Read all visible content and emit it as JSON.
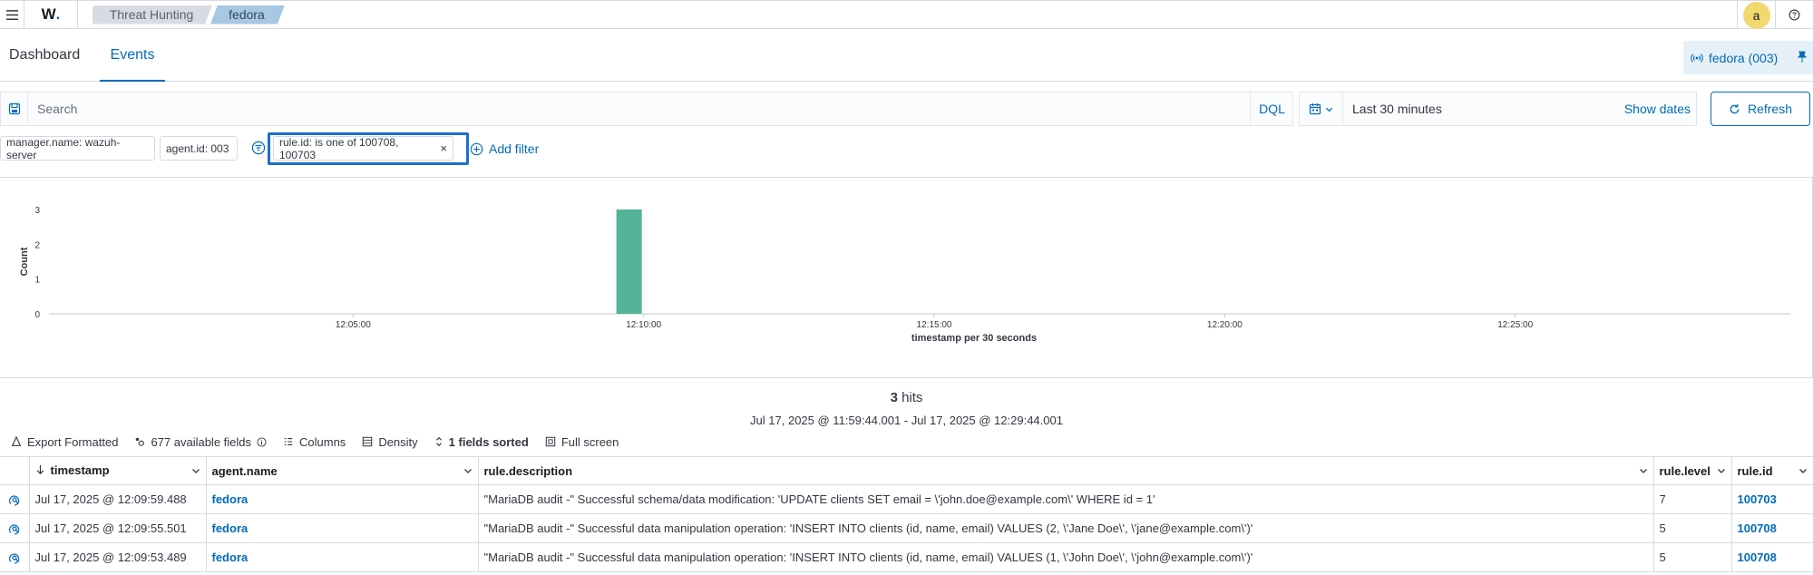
{
  "header": {
    "logo_text": "W",
    "logo_dot": ".",
    "breadcrumbs": [
      "Threat Hunting",
      "fedora"
    ],
    "avatar_letter": "a"
  },
  "tabs": {
    "dashboard": "Dashboard",
    "events": "Events",
    "agent_pill": "fedora (003)"
  },
  "query": {
    "placeholder": "Search",
    "language": "DQL",
    "time_range": "Last 30 minutes",
    "show_dates": "Show dates",
    "refresh": "Refresh"
  },
  "filters": {
    "items": [
      "manager.name: wazuh-server",
      "agent.id: 003",
      "rule.id: is one of 100708, 100703"
    ],
    "close_glyph": "×",
    "add_filter": "Add filter"
  },
  "chart_data": {
    "type": "bar",
    "xlabel": "timestamp per 30 seconds",
    "ylabel": "Count",
    "ylim": [
      0,
      3
    ],
    "y_ticks": [
      "0",
      "1",
      "2",
      "3"
    ],
    "x_ticks": [
      "12:05:00",
      "12:10:00",
      "12:15:00",
      "12:20:00",
      "12:25:00"
    ],
    "bars": [
      {
        "x": "12:09:30",
        "value": 3
      }
    ],
    "color": "#54b399"
  },
  "results": {
    "hits_count": "3",
    "hits_label": " hits",
    "date_range": "Jul 17, 2025 @ 11:59:44.001 - Jul 17, 2025 @ 12:29:44.001"
  },
  "toolbar": {
    "export": "Export Formatted",
    "fields": "677 available fields",
    "columns": "Columns",
    "density": "Density",
    "sorted": "1 fields sorted",
    "fullscreen": "Full screen"
  },
  "table": {
    "columns": [
      "timestamp",
      "agent.name",
      "rule.description",
      "rule.level",
      "rule.id"
    ],
    "rows": [
      {
        "timestamp": "Jul 17, 2025 @ 12:09:59.488",
        "agent": "fedora",
        "description": "\"MariaDB audit -\" Successful schema/data modification: 'UPDATE clients SET email = \\'john.doe@example.com\\' WHERE id = 1'",
        "level": "7",
        "id": "100703"
      },
      {
        "timestamp": "Jul 17, 2025 @ 12:09:55.501",
        "agent": "fedora",
        "description": "\"MariaDB audit -\" Successful data manipulation operation: 'INSERT INTO clients (id, name, email) VALUES (2, \\'Jane Doe\\', \\'jane@example.com\\')'",
        "level": "5",
        "id": "100708"
      },
      {
        "timestamp": "Jul 17, 2025 @ 12:09:53.489",
        "agent": "fedora",
        "description": "\"MariaDB audit -\" Successful data manipulation operation: 'INSERT INTO clients (id, name, email) VALUES (1, \\'John Doe\\', \\'john@example.com\\')'",
        "level": "5",
        "id": "100708"
      }
    ]
  }
}
